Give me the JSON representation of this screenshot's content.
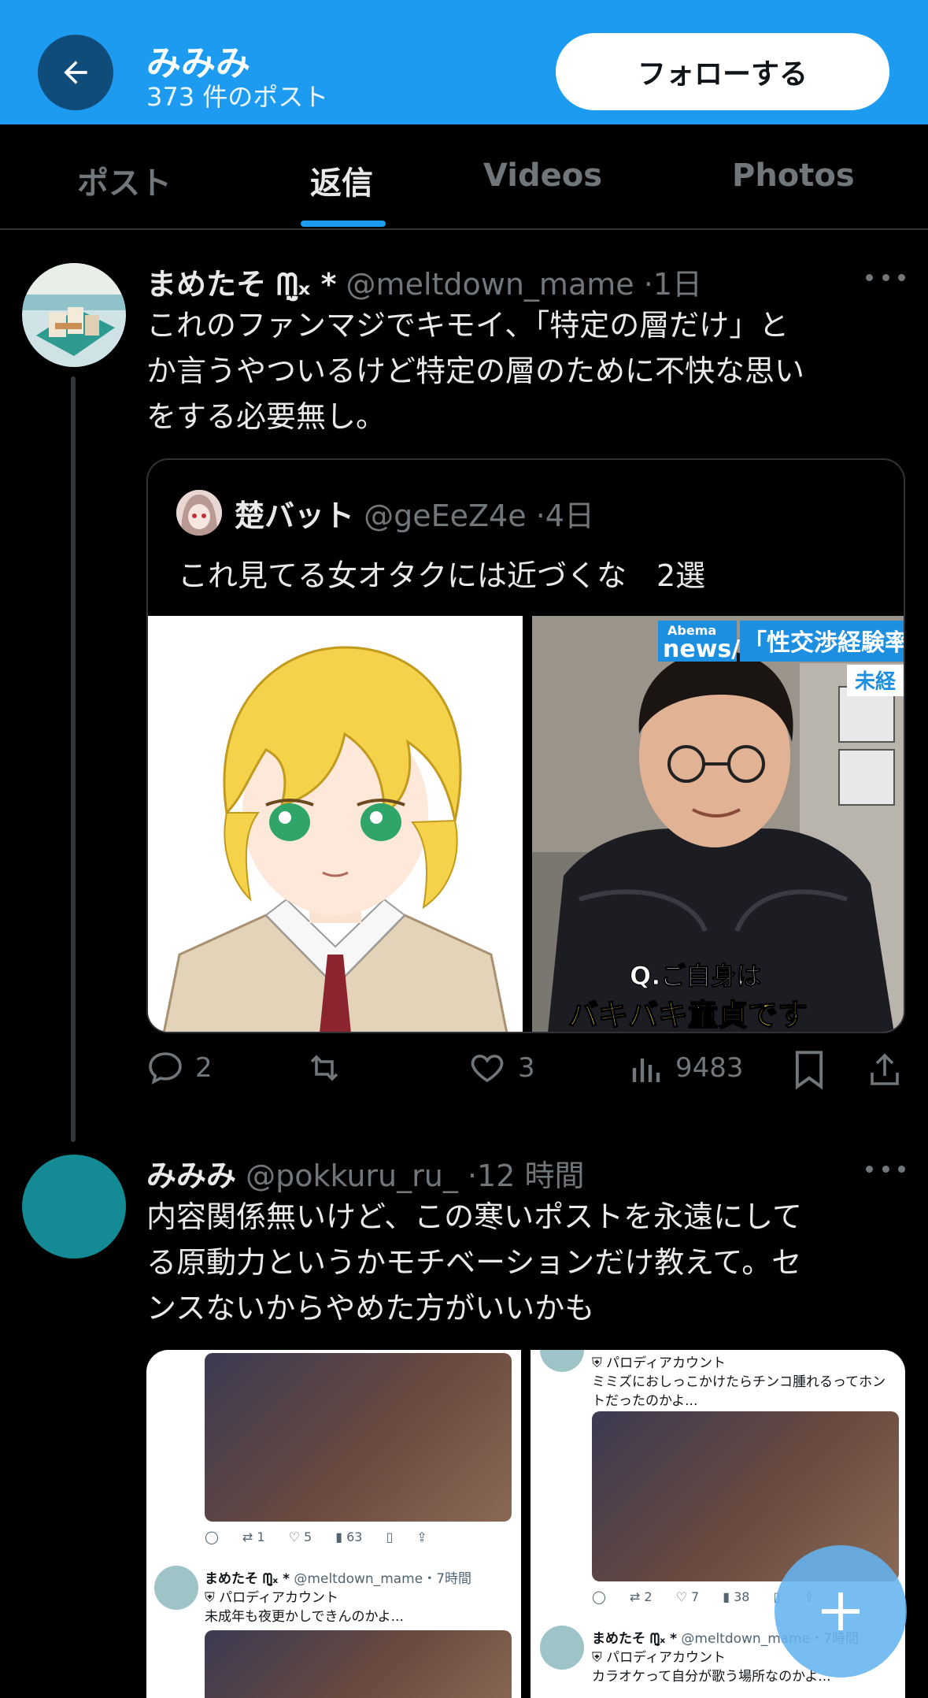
{
  "header": {
    "name": "みみみ",
    "post_count": "373 件のポスト",
    "follow_label": "フォローする"
  },
  "tabs": [
    {
      "label": "ポスト",
      "active": false
    },
    {
      "label": "返信",
      "active": true
    },
    {
      "label": "Videos",
      "active": false
    },
    {
      "label": "Photos",
      "active": false
    }
  ],
  "posts": [
    {
      "name": "まめたそ ᗰ̤̮ₓ *",
      "handle": "@meltdown_mame",
      "time": "1日",
      "text_lines": [
        "これのファンマジでキモイ、「特定の層だけ」と",
        "か言うやついるけど特定の層のために不快な思い",
        "をする必要無し。"
      ],
      "quote": {
        "name": "楚バット",
        "handle": "@geEeZ4e",
        "time": "4日",
        "text": "これ見てる女オタクには近づくな　2選",
        "media_right_caption_1": "Q.ご自身は",
        "media_right_caption_2": "バキバキ童貞です",
        "media_right_logo": "news/",
        "media_right_logo_top": "Abema",
        "media_right_banner": "「性交渉経験率",
        "media_right_banner_2": "未経"
      },
      "replies": "2",
      "reposts": "",
      "likes": "3",
      "views": "9483"
    },
    {
      "name": "みみみ",
      "handle": "@pokkuru_ru_",
      "time": "12 時間",
      "text_lines": [
        "内容関係無いけど、この寒いポストを永遠にして",
        "る原動力というかモチベーションだけ教えて。セ",
        "ンスないからやめた方がいいかも"
      ],
      "shot_left": {
        "counts": [
          "",
          "1",
          "5",
          "63"
        ],
        "name": "まめたそ ᗰ̤̮ₓ *",
        "handle": "@meltdown_mame・7時間",
        "badge": "パロディアカウント",
        "text": "未成年も夜更かしできんのかよ..."
      },
      "shot_right": {
        "badge_top": "パロディアカウント",
        "text_1": "ミミズにおしっこかけたらチンコ腫れるってホン",
        "text_2": "トだったのかよ...",
        "counts": [
          "",
          "2",
          "7",
          "38"
        ],
        "name": "まめたそ ᗰ̤̮ₓ *",
        "handle": "@meltdown_mame・7時間",
        "badge": "パロディアカウント",
        "text": "カラオケって自分が歌う場所なのかよ..."
      }
    }
  ],
  "colors": {
    "accent": "#1d9bf0",
    "header_bg": "#1d9bf0",
    "back_btn_bg": "#0f4c7a",
    "text_primary": "#e7e9ea",
    "text_secondary": "#71767b",
    "avatar_teal": "#138a94"
  },
  "icons": {
    "back": "arrow-left-icon",
    "more": "more-dots-icon",
    "reply": "reply-icon",
    "repost": "repost-icon",
    "like": "heart-icon",
    "views": "views-icon",
    "bookmark": "bookmark-icon",
    "share": "share-icon",
    "compose": "plus-icon"
  }
}
